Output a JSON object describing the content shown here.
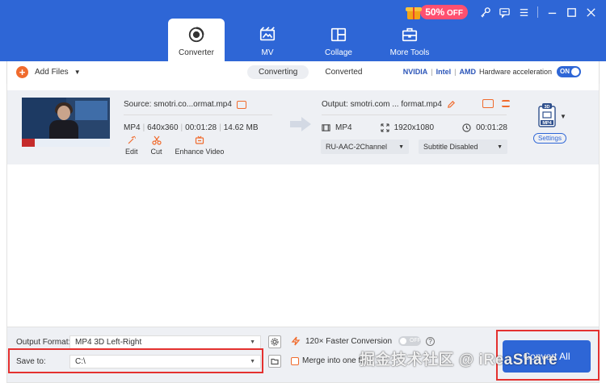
{
  "window": {
    "promo_percent": "50%",
    "promo_off": "OFF",
    "controls": [
      "key-icon",
      "feedback-icon",
      "menu-icon",
      "minimize-icon",
      "maximize-icon",
      "close-icon"
    ]
  },
  "tabs": [
    {
      "label": "Converter",
      "icon": "converter-icon",
      "active": true
    },
    {
      "label": "MV",
      "icon": "mv-icon",
      "active": false
    },
    {
      "label": "Collage",
      "icon": "collage-icon",
      "active": false
    },
    {
      "label": "More Tools",
      "icon": "toolbox-icon",
      "active": false
    }
  ],
  "toolbar": {
    "add_files": "Add Files",
    "segments": [
      "Converting",
      "Converted"
    ],
    "hw_brands": [
      "NVIDIA",
      "Intel",
      "AMD"
    ],
    "hw_label": "Hardware acceleration",
    "hw_toggle": "ON"
  },
  "file": {
    "source": "Source: smotri.co...ormat.mp4",
    "meta": [
      "MP4",
      "640x360",
      "00:01:28",
      "14.62 MB"
    ],
    "tools": [
      "Edit",
      "Cut",
      "Enhance Video"
    ],
    "output": "Output: smotri.com ... format.mp4",
    "out_format": "MP4",
    "out_resolution": "1920x1080",
    "out_duration": "00:01:28",
    "audio_track": "RU-AAC-2Channel",
    "subtitle": "Subtitle Disabled",
    "format_badge_top": "3D",
    "format_badge": "MP4",
    "settings": "Settings"
  },
  "footer": {
    "output_format_label": "Output Format:",
    "output_format_value": "MP4 3D Left-Right",
    "save_to_label": "Save to:",
    "save_to_value": "C:\\",
    "faster_label": "120× Faster Conversion",
    "faster_toggle": "OFF",
    "merge_label": "Merge into one file",
    "convert_all": "Convert All"
  },
  "watermark": "掘金技术社区 @ iReaShare",
  "colors": {
    "header_blue": "#2e66d6",
    "accent_orange": "#f06b2d",
    "promo_pink": "#ff5070",
    "highlight_red": "#e4312f"
  }
}
